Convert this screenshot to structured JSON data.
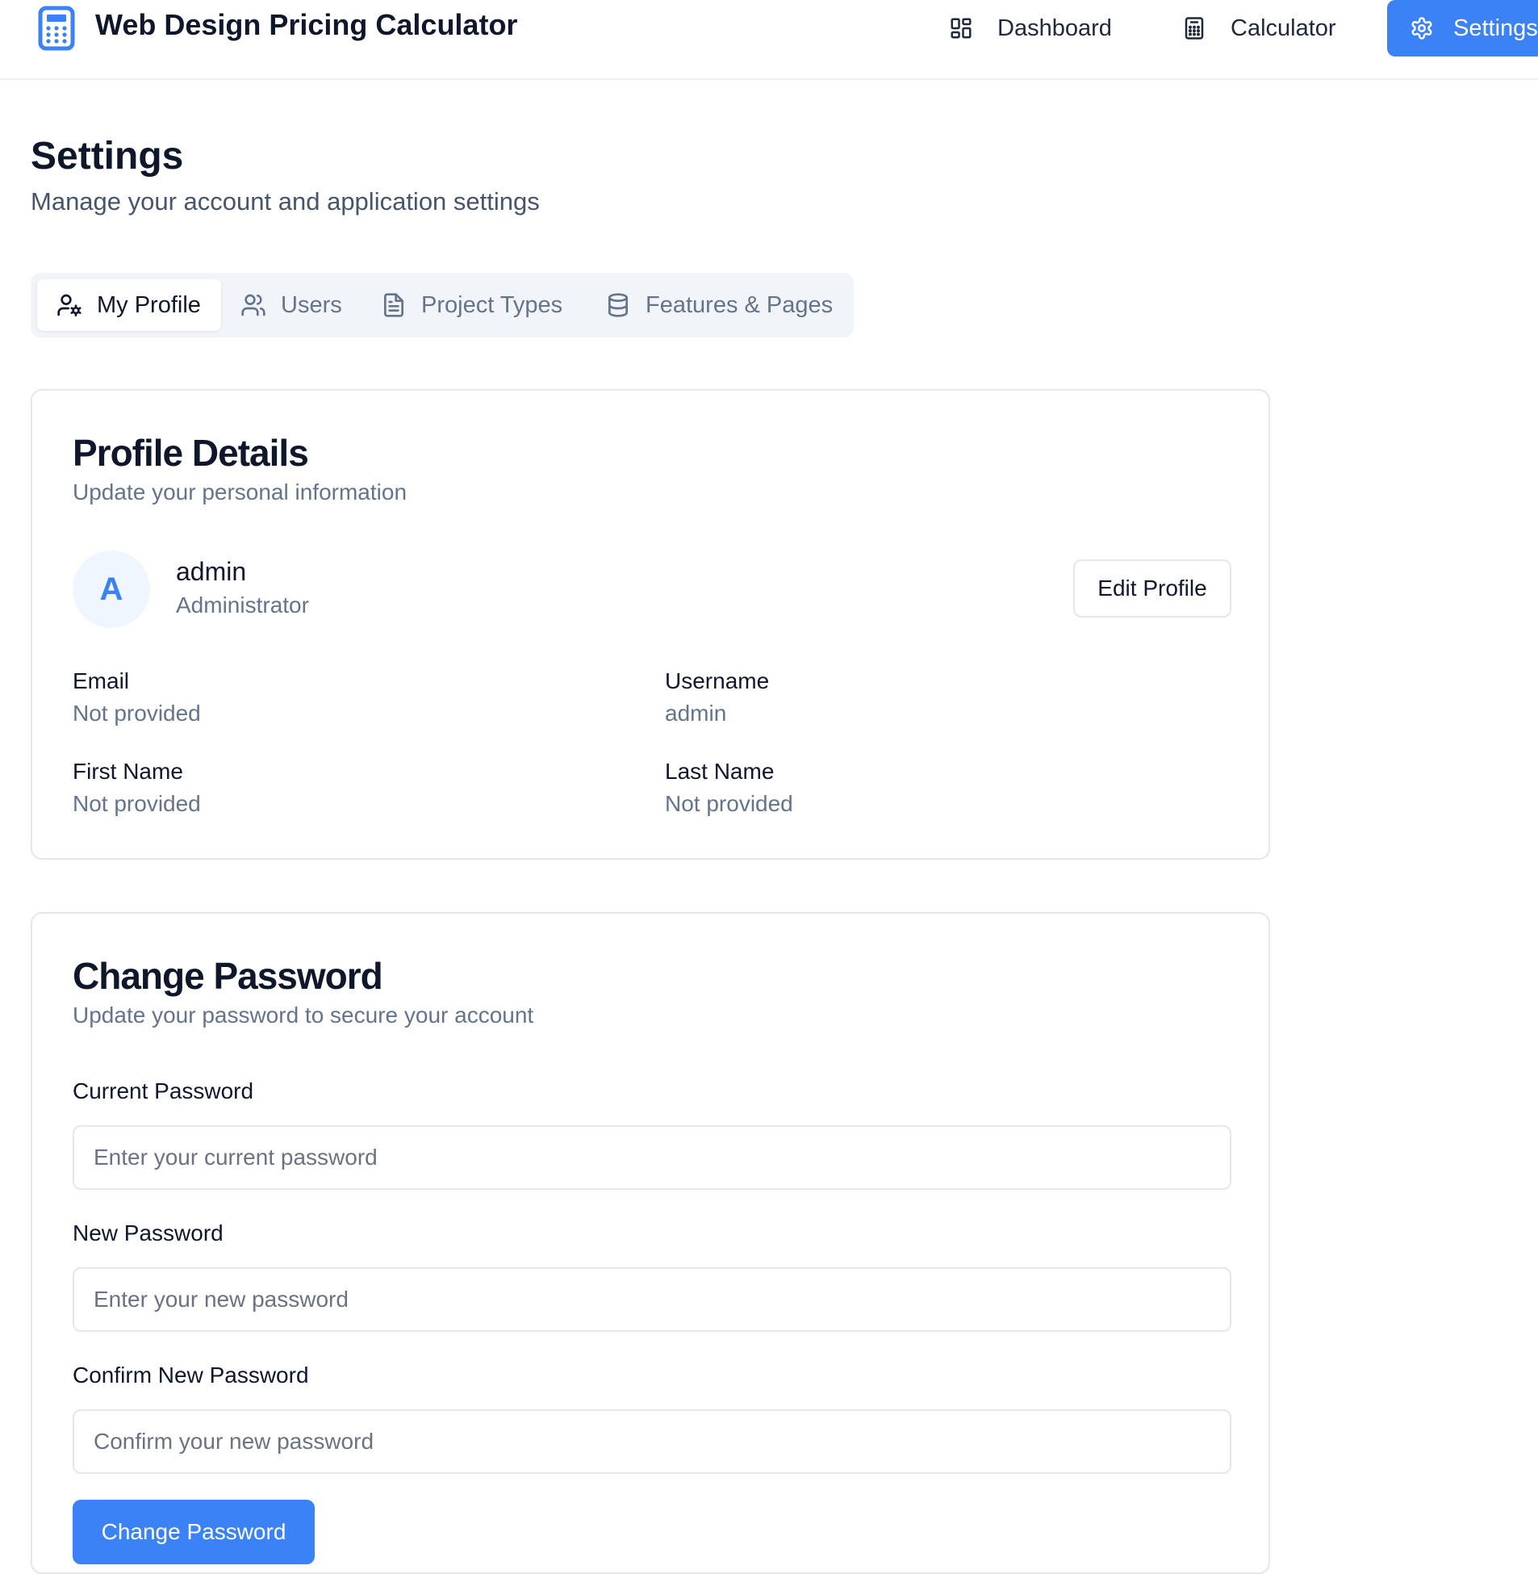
{
  "app": {
    "title": "Web Design Pricing Calculator",
    "accent_color": "#3b82f6"
  },
  "nav": {
    "items": [
      {
        "label": "Dashboard",
        "icon": "layout-grid-icon"
      },
      {
        "label": "Calculator",
        "icon": "calculator-icon"
      },
      {
        "label": "Settings",
        "icon": "gear-icon",
        "active": true
      }
    ]
  },
  "page": {
    "title": "Settings",
    "subtitle": "Manage your account and application settings"
  },
  "tabs": [
    {
      "label": "My Profile",
      "icon": "user-cog-icon",
      "active": true
    },
    {
      "label": "Users",
      "icon": "users-icon"
    },
    {
      "label": "Project Types",
      "icon": "file-text-icon"
    },
    {
      "label": "Features & Pages",
      "icon": "database-icon"
    }
  ],
  "profile": {
    "title": "Profile Details",
    "subtitle": "Update your personal information",
    "avatar_initial": "A",
    "name": "admin",
    "role": "Administrator",
    "edit_button": "Edit Profile",
    "fields": [
      {
        "label": "Email",
        "value": "Not provided"
      },
      {
        "label": "Username",
        "value": "admin"
      },
      {
        "label": "First Name",
        "value": "Not provided"
      },
      {
        "label": "Last Name",
        "value": "Not provided"
      }
    ]
  },
  "password": {
    "title": "Change Password",
    "subtitle": "Update your password to secure your account",
    "current_label": "Current Password",
    "current_placeholder": "Enter your current password",
    "new_label": "New Password",
    "new_placeholder": "Enter your new password",
    "confirm_label": "Confirm New Password",
    "confirm_placeholder": "Confirm your new password",
    "submit_button": "Change Password"
  }
}
